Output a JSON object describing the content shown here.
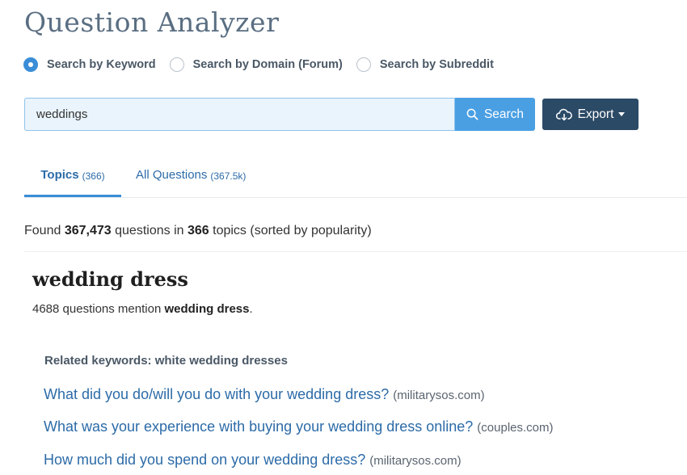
{
  "app": {
    "title": "Question Analyzer"
  },
  "search_modes": [
    {
      "label": "Search by Keyword",
      "checked": true
    },
    {
      "label": "Search by Domain (Forum)",
      "checked": false
    },
    {
      "label": "Search by Subreddit",
      "checked": false
    }
  ],
  "search": {
    "value": "weddings",
    "button_label": "Search",
    "button_icon": "search-icon"
  },
  "export": {
    "label": "Export",
    "icon": "cloud-download-icon"
  },
  "tabs": [
    {
      "label": "Topics",
      "count": "(366)",
      "active": true
    },
    {
      "label": "All Questions",
      "count": "(367.5k)",
      "active": false
    }
  ],
  "summary": {
    "prefix": "Found",
    "questions": "367,473",
    "middle": "questions in",
    "topics": "366",
    "suffix": "topics (sorted by popularity)"
  },
  "topic": {
    "name": "wedding dress",
    "count_text": "4688 questions mention",
    "count_keyword": "wedding dress",
    "count_suffix": ".",
    "related_label": "Related keywords: white wedding dresses",
    "questions": [
      {
        "text": "What did you do/will you do with your wedding dress?",
        "source": "(militarysos.com)"
      },
      {
        "text": "What was your experience with buying your wedding dress online?",
        "source": "(couples.com)"
      },
      {
        "text": "How much did you spend on your wedding dress?",
        "source": "(militarysos.com)"
      }
    ]
  },
  "colors": {
    "accent": "#3a8ed8",
    "search_button": "#4a9fe3",
    "export_button": "#2b4a66",
    "link": "#2c6ba8"
  }
}
